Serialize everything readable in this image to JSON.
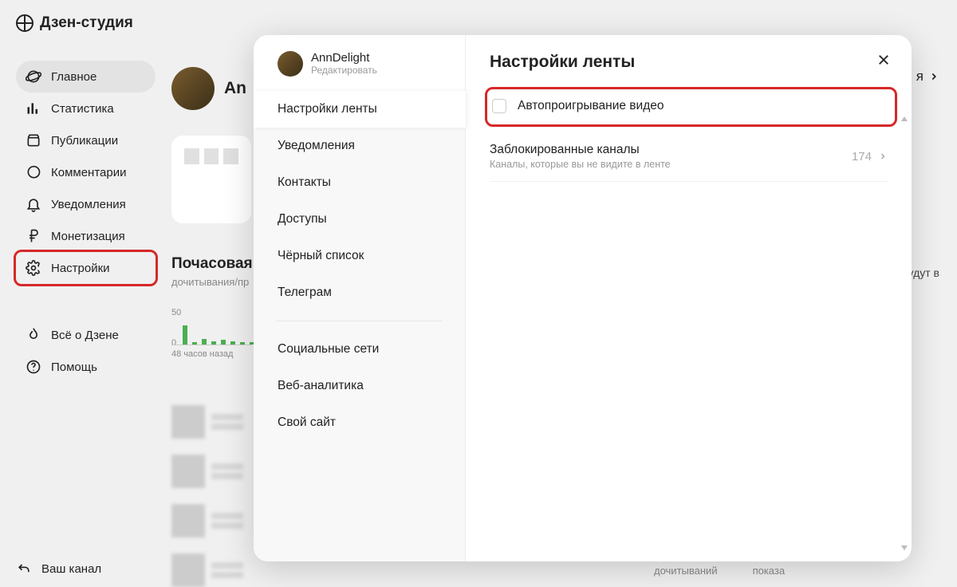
{
  "brand": "Дзен-студия",
  "sidebar": {
    "items": [
      {
        "label": "Главное",
        "icon": "planet"
      },
      {
        "label": "Статистика",
        "icon": "bars"
      },
      {
        "label": "Публикации",
        "icon": "box"
      },
      {
        "label": "Комментарии",
        "icon": "chat"
      },
      {
        "label": "Уведомления",
        "icon": "bell"
      },
      {
        "label": "Монетизация",
        "icon": "ruble"
      },
      {
        "label": "Настройки",
        "icon": "gear"
      },
      {
        "label": "Всё о Дзене",
        "icon": "fire"
      },
      {
        "label": "Помощь",
        "icon": "help"
      }
    ],
    "footer": "Ваш канал"
  },
  "main": {
    "profile_name_prefix": "An",
    "right_header_suffix": "я",
    "right_hint": "ь будут в",
    "stats_title": "Почасовая",
    "stats_sub": "дочитывания/пр",
    "chart_data": {
      "type": "bar",
      "ylim": [
        0,
        50
      ],
      "values": [
        34,
        4,
        10,
        6,
        8,
        6,
        4,
        4
      ],
      "xlabel": "48 часов назад",
      "y_top_label": "50",
      "y_bottom_label": "0"
    },
    "bottom_stats": [
      "дочитываний",
      "показа"
    ]
  },
  "modal": {
    "profile": {
      "name": "AnnDelight",
      "edit": "Редактировать"
    },
    "tabs_group1": [
      "Настройки ленты",
      "Уведомления",
      "Контакты",
      "Доступы",
      "Чёрный список",
      "Телеграм"
    ],
    "tabs_group2": [
      "Социальные сети",
      "Веб-аналитика",
      "Свой сайт"
    ],
    "title": "Настройки ленты",
    "autoplay": {
      "label": "Автопроигрывание видео",
      "checked": false
    },
    "blocked": {
      "title": "Заблокированные каналы",
      "sub": "Каналы, которые вы не видите в ленте",
      "count": "174"
    }
  }
}
